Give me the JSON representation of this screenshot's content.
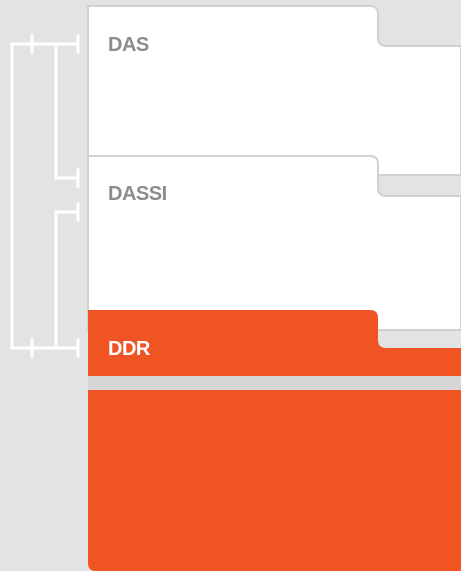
{
  "folders": [
    {
      "label": "DAS"
    },
    {
      "label": "DASSI"
    },
    {
      "label": "DDR"
    }
  ],
  "colors": {
    "background": "#e3e3e4",
    "folder_light": "#ffffff",
    "folder_light_edge": "#d0d0d2",
    "folder_accent": "#f05423",
    "label_muted": "#8c8c8e",
    "label_on_accent": "#ffffff",
    "bracket": "#ffffff"
  }
}
